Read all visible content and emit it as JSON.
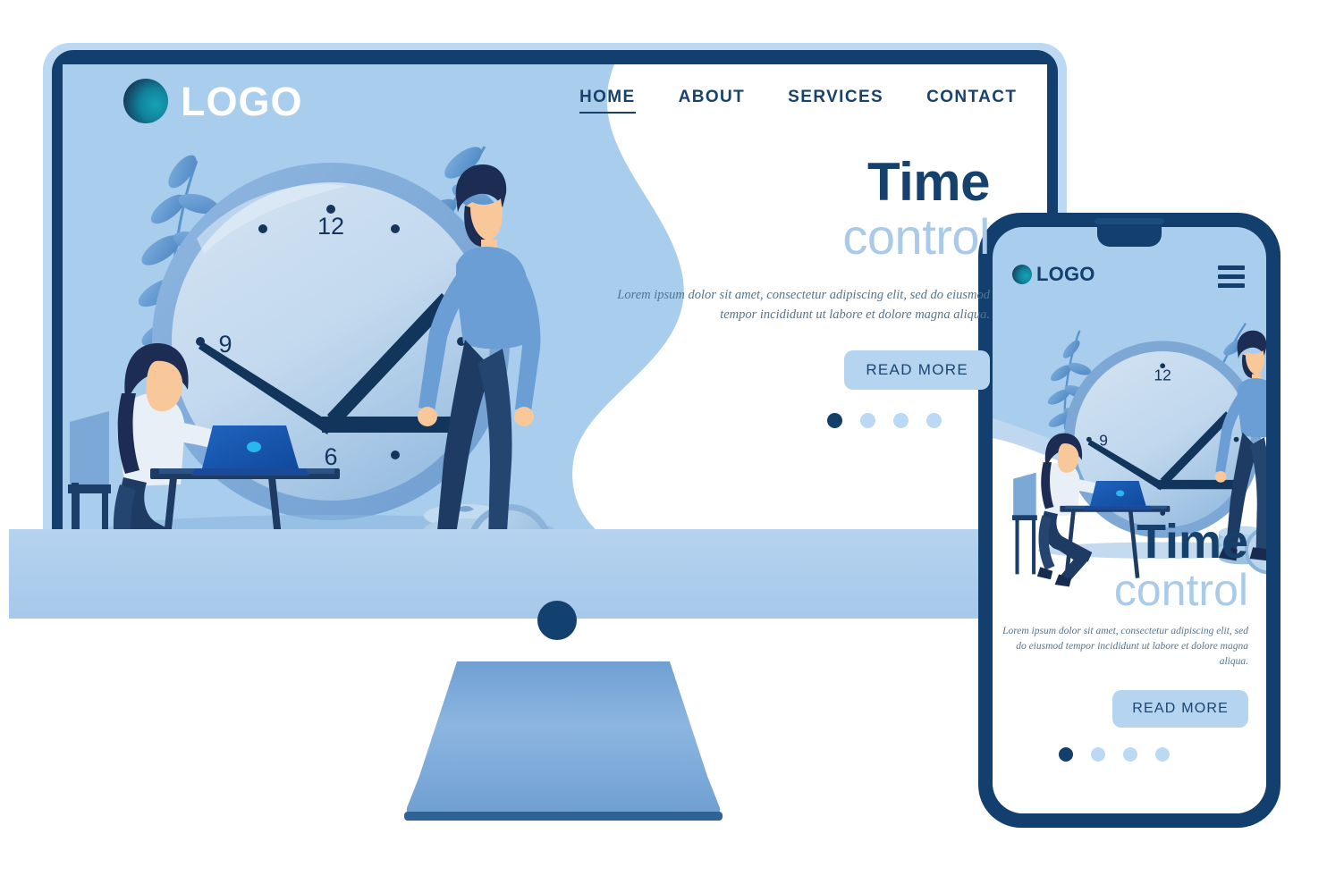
{
  "brand": {
    "name": "LOGO",
    "mark": "circle-gradient-mark"
  },
  "desktop": {
    "nav": [
      {
        "label": "HOME",
        "active": true
      },
      {
        "label": "ABOUT",
        "active": false
      },
      {
        "label": "SERVICES",
        "active": false
      },
      {
        "label": "CONTACT",
        "active": false
      }
    ],
    "hero": {
      "title": "Time",
      "subtitle": "control",
      "description": "Lorem ipsum dolor sit amet, consectetur adipiscing elit, sed do eiusmod tempor incididunt ut labore et dolore magna aliqua.",
      "cta": "READ MORE",
      "carousel": {
        "count": 4,
        "active_index": 0
      }
    }
  },
  "phone": {
    "brand_name": "LOGO",
    "menu_icon": "hamburger-icon",
    "hero": {
      "title": "Time",
      "subtitle": "control",
      "description": "Lorem ipsum dolor sit amet, consectetur adipiscing elit, sed do eiusmod tempor incididunt ut labore et dolore magna aliqua.",
      "cta": "READ MORE",
      "carousel": {
        "count": 4,
        "active_index": 0
      }
    }
  },
  "illustration": {
    "name": "time-management-illustration",
    "clock_numerals": [
      "12",
      "9",
      "6"
    ],
    "elements": [
      "wall-clock",
      "woman-at-desk-with-laptop",
      "standing-man",
      "stacked-coins",
      "leaf-branches"
    ]
  },
  "colors": {
    "screen_bg": "#a9cdec",
    "frame_navy": "#123f6d",
    "accent_light": "#b4d4f0",
    "title_navy": "#17416d",
    "subtitle_blue": "#a9cbe9",
    "body_text": "#53758f",
    "white": "#ffffff"
  }
}
